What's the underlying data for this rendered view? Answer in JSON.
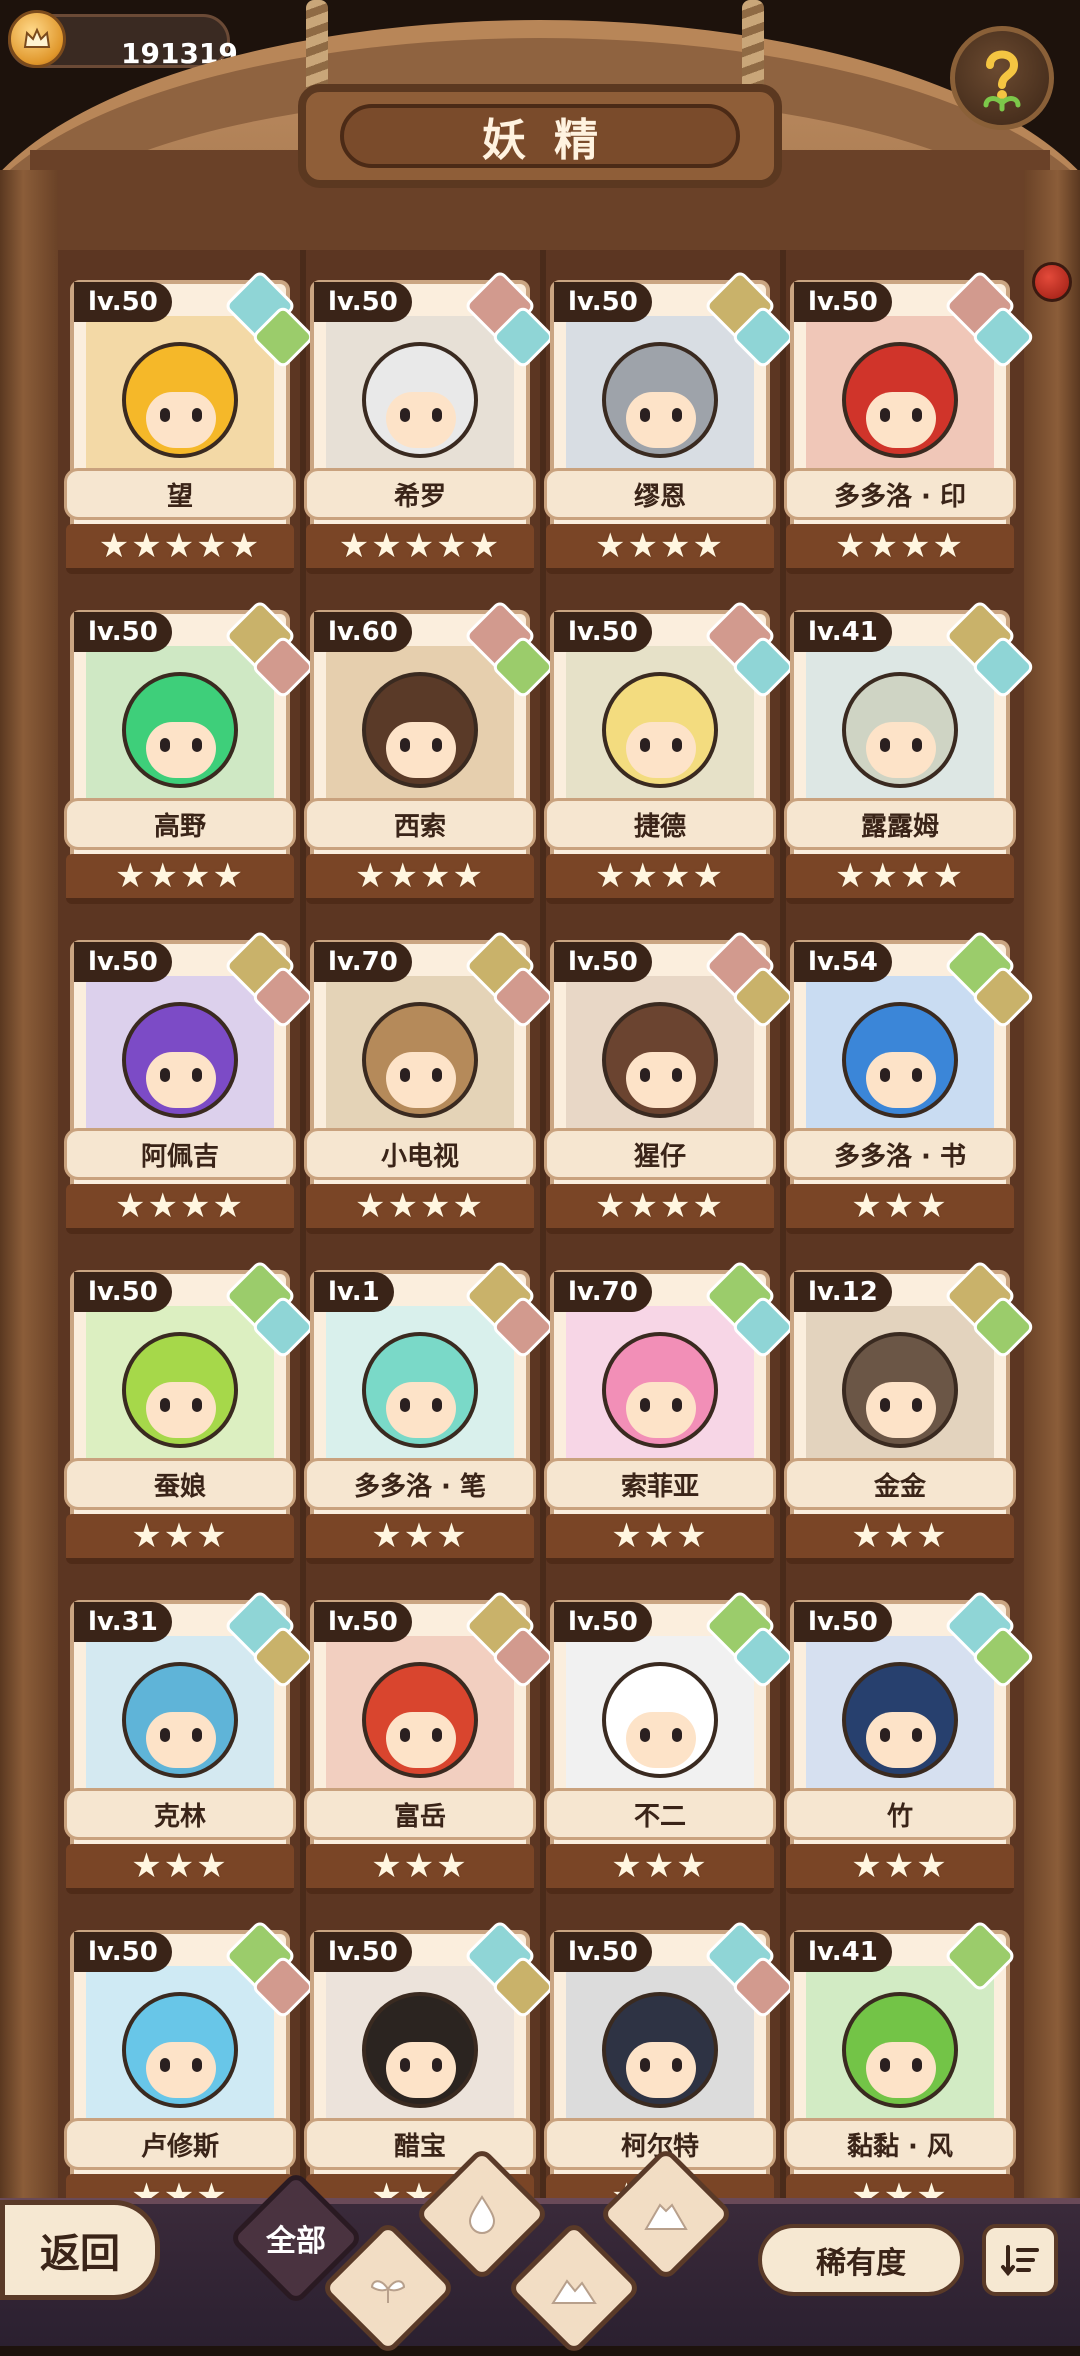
{
  "currency": {
    "amount": "191319",
    "icon": "crown-coin-icon"
  },
  "header": {
    "title": "妖精",
    "help_icon": "question-sprout-icon"
  },
  "fairies": [
    {
      "level": "lv.50",
      "name": "望",
      "stars": 5,
      "elements": [
        "water",
        "plant"
      ]
    },
    {
      "level": "lv.50",
      "name": "希罗",
      "stars": 5,
      "elements": [
        "fire",
        "water"
      ]
    },
    {
      "level": "lv.50",
      "name": "缪恩",
      "stars": 4,
      "elements": [
        "earth",
        "water"
      ]
    },
    {
      "level": "lv.50",
      "name": "多多洛 · 印",
      "stars": 4,
      "elements": [
        "fire",
        "water"
      ]
    },
    {
      "level": "lv.50",
      "name": "高野",
      "stars": 4,
      "elements": [
        "earth",
        "fire"
      ]
    },
    {
      "level": "lv.60",
      "name": "西索",
      "stars": 4,
      "elements": [
        "fire",
        "plant"
      ]
    },
    {
      "level": "lv.50",
      "name": "捷德",
      "stars": 4,
      "elements": [
        "fire",
        "water"
      ]
    },
    {
      "level": "lv.41",
      "name": "露露姆",
      "stars": 4,
      "elements": [
        "earth",
        "water"
      ]
    },
    {
      "level": "lv.50",
      "name": "阿佩吉",
      "stars": 4,
      "elements": [
        "earth",
        "fire"
      ]
    },
    {
      "level": "lv.70",
      "name": "小电视",
      "stars": 4,
      "elements": [
        "earth",
        "fire"
      ]
    },
    {
      "level": "lv.50",
      "name": "猩仔",
      "stars": 4,
      "elements": [
        "fire",
        "earth"
      ]
    },
    {
      "level": "lv.54",
      "name": "多多洛 · 书",
      "stars": 3,
      "elements": [
        "plant",
        "earth"
      ]
    },
    {
      "level": "lv.50",
      "name": "蚕娘",
      "stars": 3,
      "elements": [
        "plant",
        "water"
      ]
    },
    {
      "level": "lv.1",
      "name": "多多洛 · 笔",
      "stars": 3,
      "elements": [
        "earth",
        "fire"
      ]
    },
    {
      "level": "lv.70",
      "name": "索菲亚",
      "stars": 3,
      "elements": [
        "plant",
        "water"
      ]
    },
    {
      "level": "lv.12",
      "name": "金金",
      "stars": 3,
      "elements": [
        "earth",
        "plant"
      ]
    },
    {
      "level": "lv.31",
      "name": "克林",
      "stars": 3,
      "elements": [
        "water",
        "earth"
      ]
    },
    {
      "level": "lv.50",
      "name": "富岳",
      "stars": 3,
      "elements": [
        "earth",
        "fire"
      ]
    },
    {
      "level": "lv.50",
      "name": "不二",
      "stars": 3,
      "elements": [
        "plant",
        "water"
      ]
    },
    {
      "level": "lv.50",
      "name": "竹",
      "stars": 3,
      "elements": [
        "water",
        "plant"
      ]
    },
    {
      "level": "lv.50",
      "name": "卢修斯",
      "stars": 3,
      "elements": [
        "plant",
        "fire"
      ]
    },
    {
      "level": "lv.50",
      "name": "醋宝",
      "stars": 3,
      "elements": [
        "water",
        "earth"
      ]
    },
    {
      "level": "lv.50",
      "name": "柯尔特",
      "stars": 3,
      "elements": [
        "water",
        "fire"
      ]
    },
    {
      "level": "lv.41",
      "name": "黏黏 · 风",
      "stars": 3,
      "elements": [
        "plant"
      ]
    }
  ],
  "bottom": {
    "back_label": "返回",
    "filter_all_label": "全部",
    "filters": [
      "water",
      "plant",
      "fire",
      "earth"
    ],
    "sort_label": "稀有度",
    "order_icon": "sort-order-icon"
  },
  "colors": {
    "water": "#8fd5d6",
    "earth": "#c9b26a",
    "fire": "#d29a8e",
    "plant": "#9bcc6b",
    "wood": "#6a4128",
    "paper": "#fbeedd"
  }
}
